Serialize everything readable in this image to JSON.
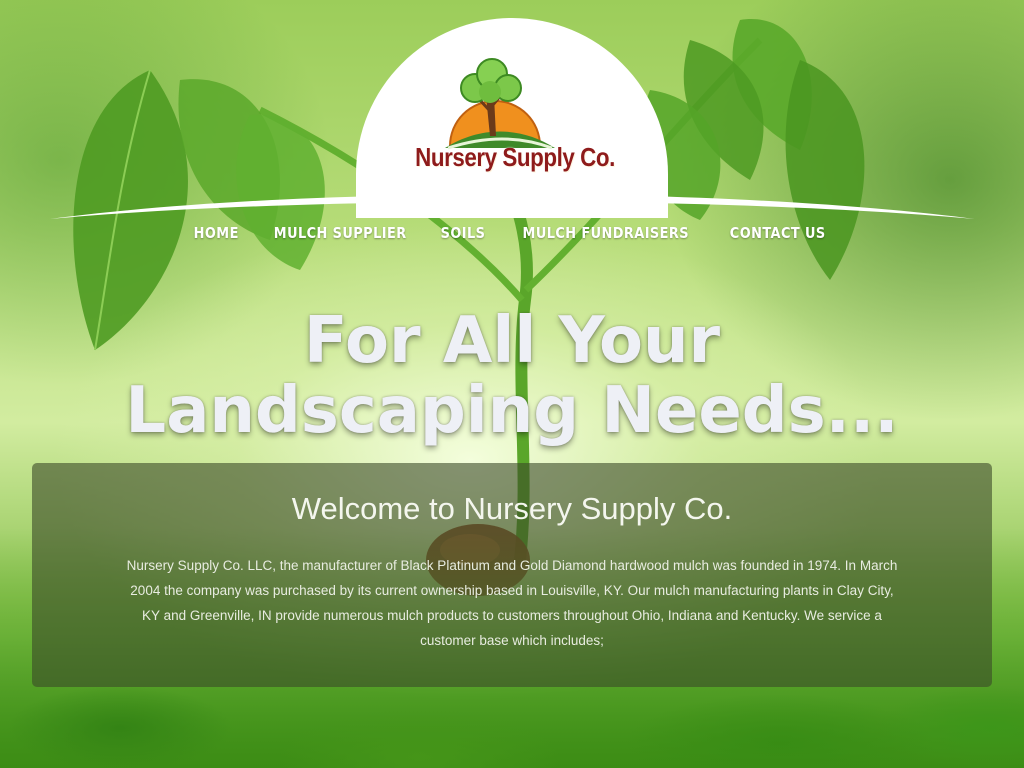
{
  "brand": {
    "name": "Nursery Supply Co."
  },
  "nav": {
    "items": [
      {
        "label": "HOME"
      },
      {
        "label": "MULCH SUPPLIER"
      },
      {
        "label": "SOILS"
      },
      {
        "label": "MULCH FUNDRAISERS"
      },
      {
        "label": "CONTACT US"
      }
    ]
  },
  "hero": {
    "line1": "For All Your",
    "line2": "Landscaping Needs..."
  },
  "welcome": {
    "title": "Welcome to Nursery Supply Co.",
    "body": "Nursery Supply Co. LLC, the manufacturer of Black Platinum and Gold Diamond hardwood mulch was founded in 1974. In March 2004 the company was purchased by its current ownership based in Louisville, KY. Our mulch manufacturing plants in Clay City, KY and Greenville, IN provide numerous mulch products to customers throughout Ohio, Indiana and Kentucky. We service a customer base which includes;"
  },
  "colors": {
    "brand_text": "#8e1b1b",
    "logo_sun": "#f0901e",
    "logo_tree": "#6cc13a",
    "panel_bg": "#3a4a28"
  },
  "icons": {
    "logo": "tree-sun-logo"
  }
}
